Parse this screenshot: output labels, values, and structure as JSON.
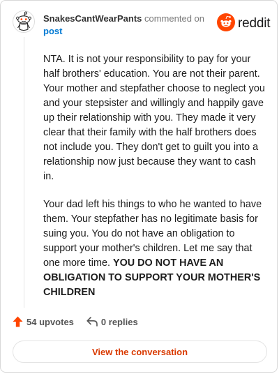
{
  "header": {
    "username": "SnakesCantWearPants",
    "action_text": "commented on",
    "post_link": "post",
    "logo_text": "reddit"
  },
  "comment": {
    "paragraph_1": "NTA. It is not your responsibility to pay for your half brothers' education. You are not their parent. Your mother and stepfather choose to neglect you and your stepsister and willingly and happily gave up their relationship with you. They made it very clear that their family with the half brothers does not include you. They don't get to guilt you into a relationship now just because they want to cash in.",
    "paragraph_2_plain": "Your dad left his things to who he wanted to have them. Your stepfather has no legitimate basis for suing you. You do not have an obligation to support your mother's children. Let me say that one more time.",
    "paragraph_2_bold": "YOU DO NOT HAVE AN OBLIGATION TO SUPPORT YOUR MOTHER'S CHILDREN"
  },
  "footer": {
    "upvotes": "54 upvotes",
    "replies": "0 replies",
    "view_button": "View the conversation"
  },
  "colors": {
    "accent": "#ff4500",
    "link": "#0079d3",
    "button_text": "#d93a00"
  },
  "icons": {
    "avatar": "snoo-avatar-icon",
    "logo": "reddit-logo-icon",
    "upvote": "upvote-arrow-icon",
    "reply": "reply-icon"
  }
}
